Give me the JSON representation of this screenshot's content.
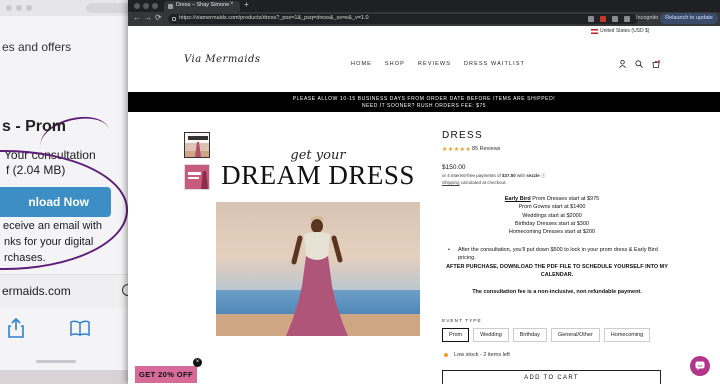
{
  "phone": {
    "offers_text": "es and offers",
    "title": "s - Prom",
    "consult_line": "Your consultation",
    "size_line": "f (2.04 MB)",
    "download_label": "nload Now",
    "line1": "eceive an email with",
    "line2": "nks for your digital",
    "line3": "rchases.",
    "url": "ermaids.com"
  },
  "browser": {
    "tab_title": "Dress – Shay Simone",
    "tab_close": "×",
    "new_tab": "+",
    "url": "https://viamermaids.com/products/dress?_pos=1&_psq=dress&_ss=e&_v=1.0",
    "incognito_label": "Incognito",
    "relaunch_label": "Relaunch to update",
    "back_icon": "←",
    "forward_icon": "→",
    "reload_icon": "⟳"
  },
  "site": {
    "currency": "United States (USD $)",
    "logo_text": "Via Mermaids",
    "nav": [
      "HOME",
      "SHOP",
      "REVIEWS",
      "DRESS WAITLIST"
    ],
    "announcement_line1": "PLEASE ALLOW 10-15 BUSINESS DAYS FROM ORDER DATE BEFORE ITEMS ARE SHIPPED!",
    "announcement_line2": "NEED IT SOONER? RUSH ORDERS FEE: $75"
  },
  "hero": {
    "script_text": "get your",
    "headline": "DREAM DRESS"
  },
  "product": {
    "title": "DRESS",
    "stars": "★★★★★",
    "rating": 5,
    "reviews": "85 Reviews",
    "price": "$150.00",
    "installments_prefix": "or 4 interest-free payments of ",
    "installment_amount": "$37.50",
    "installments_with": " with ",
    "sezzle": "sezzle",
    "shipping_link": "Shipping",
    "shipping_rest": " calculated at checkout.",
    "early_bird_link": "Early Bird",
    "early_bird_rest": " Prom Dresses start at $975",
    "price_lines": [
      "Prom Gowns start at $1400",
      "Weddings start at $2000",
      "Birthday Dresses start at $300",
      "Homecoming Dresses start at $200"
    ],
    "bullet": "After the consultation, you'll put down $500 to lock in your prom dress & Early Bird pricing.",
    "after_purchase": "AFTER PURCHASE, DOWNLOAD THE PDF FILE TO SCHEDULE YOURSELF INTO MY CALENDAR.",
    "consult_fee": "The consultation fee is a non-inclusive, non refundable payment.",
    "options_label": "EVENT TYPE",
    "options": [
      "Prom",
      "Wedding",
      "Birthday",
      "General/Other",
      "Homecoming"
    ],
    "selected_option": "Prom",
    "low_stock": "Low stock - 2 items left",
    "add_to_cart": "ADD TO CART"
  },
  "promo": {
    "label": "GET 20% OFF",
    "close": "×"
  },
  "colors": {
    "accent_pink": "#d66b9a",
    "chat_purple": "#b2348b",
    "star_gold": "#e3a11b",
    "phone_button_blue": "#3c8ec5",
    "relaunch_bg": "#3a4b6a"
  },
  "icons": [
    "lock-icon",
    "user-icon",
    "search-icon",
    "cart-icon",
    "chat-icon",
    "share-icon",
    "books-icon",
    "reload-icon",
    "flag-icon"
  ]
}
